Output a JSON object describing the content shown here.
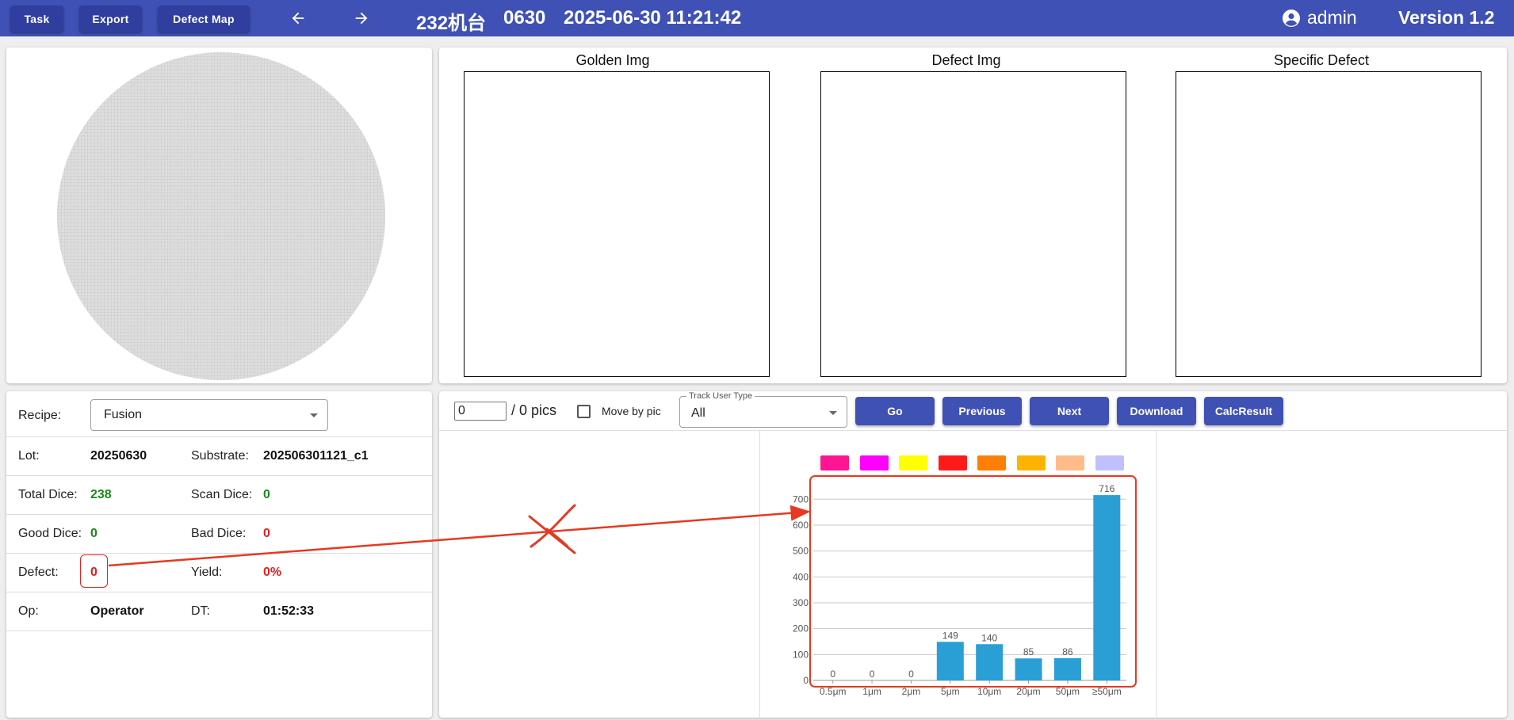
{
  "topbar": {
    "buttons": [
      "Task",
      "Export",
      "Defect Map"
    ],
    "machine": "232机台",
    "lot_short": "0630",
    "datetime": "2025-06-30 11:21:42",
    "user": "admin",
    "version": "Version 1.2"
  },
  "images": {
    "golden": "Golden Img",
    "defect": "Defect Img",
    "specific": "Specific Defect"
  },
  "info": {
    "recipe_label": "Recipe:",
    "recipe_value": "Fusion",
    "lot_label": "Lot:",
    "lot_value": "20250630",
    "substrate_label": "Substrate:",
    "substrate_value": "202506301121_c1",
    "total_dice_label": "Total Dice:",
    "total_dice_value": "238",
    "scan_dice_label": "Scan Dice:",
    "scan_dice_value": "0",
    "good_dice_label": "Good Dice:",
    "good_dice_value": "0",
    "bad_dice_label": "Bad Dice:",
    "bad_dice_value": "0",
    "defect_label": "Defect:",
    "defect_value": "0",
    "yield_label": "Yield:",
    "yield_value": "0%",
    "op_label": "Op:",
    "op_value": "Operator",
    "dt_label": "DT:",
    "dt_value": "01:52:33"
  },
  "toolbar": {
    "pic_index": "0",
    "pics_total": "/ 0 pics",
    "move_by_pic": "Move by pic",
    "track_legend": "Track User Type",
    "track_value": "All",
    "go": "Go",
    "previous": "Previous",
    "next": "Next",
    "download": "Download",
    "calc": "CalcResult"
  },
  "colors": {
    "accent": "#3f51b5",
    "bar": "#2a9fd6",
    "highlight": "#e53922",
    "swatches": [
      "#ff1493",
      "#ff00ff",
      "#ffff00",
      "#ff1a1a",
      "#ff8000",
      "#ffb300",
      "#ffbb88",
      "#c0c0ff"
    ]
  },
  "chart_data": {
    "type": "bar",
    "categories": [
      "0.5μm",
      "1μm",
      "2μm",
      "5μm",
      "10μm",
      "20μm",
      "50μm",
      "≥50μm"
    ],
    "values": [
      0,
      0,
      0,
      149,
      140,
      85,
      86,
      716
    ],
    "yticks": [
      0,
      100,
      200,
      300,
      400,
      500,
      600,
      700
    ],
    "ylim": [
      0,
      760
    ],
    "grid": true
  }
}
